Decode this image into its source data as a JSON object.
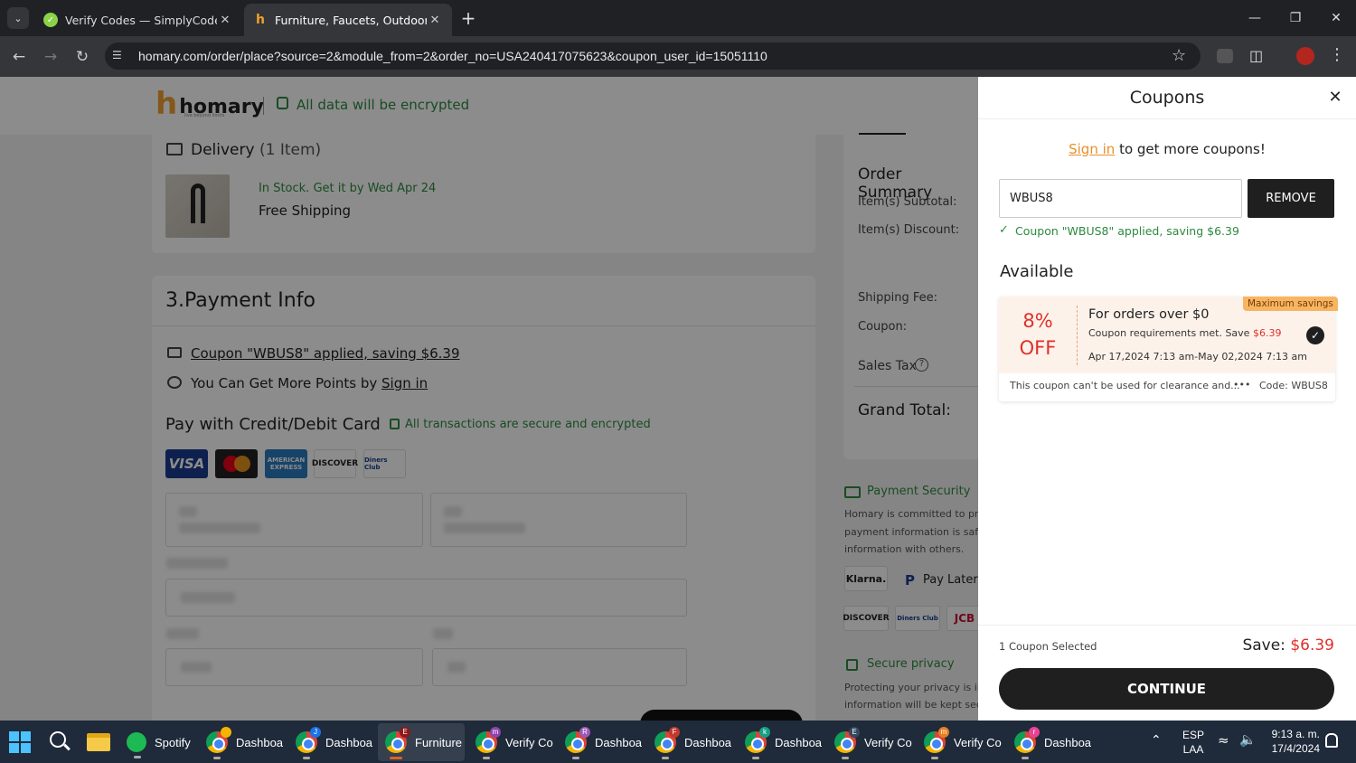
{
  "browser": {
    "tabs": [
      {
        "title": "Verify Codes — SimplyCodes",
        "active": false
      },
      {
        "title": "Furniture, Faucets, Outdoor, Lig",
        "active": true
      }
    ],
    "url": "homary.com/order/place?source=2&module_from=2&order_no=USA240417075623&coupon_user_id=15051110"
  },
  "header": {
    "logo": "homary",
    "logo_tagline": "live beyond limits",
    "encrypted_text": "All data will be encrypted"
  },
  "delivery": {
    "title": "Delivery",
    "count": "(1 Item)",
    "stock_text": "In Stock. Get it by Wed Apr 24",
    "shipping": "Free Shipping"
  },
  "payment": {
    "title": "3.Payment Info",
    "coupon_applied": "Coupon \"WBUS8\" applied, saving $6.39",
    "points_prefix": "You Can Get More Points by",
    "points_link": "Sign in",
    "card_title": "Pay with Credit/Debit Card",
    "secure_text": "All transactions are secure and encrypted",
    "card_logos": [
      "VISA",
      "mastercard",
      "AMERICAN EXPRESS",
      "DISCOVER",
      "Diners Club"
    ]
  },
  "order_summary": {
    "title": "Order Summary",
    "rows": [
      "Item(s) Subtotal:",
      "Item(s) Discount:",
      "Shipping Fee:",
      "Coupon:",
      "Sales Tax"
    ],
    "grand_total": "Grand Total:"
  },
  "security": {
    "title": "Payment Security",
    "text_lines": [
      "Homary is committed to prot",
      "payment information is safe",
      "information with others."
    ],
    "klarna": "Klarna.",
    "pay_later": "Pay Later",
    "logos": [
      "DISCOVER",
      "Diners Club",
      "JCB"
    ],
    "privacy_title": "Secure privacy",
    "privacy_lines": [
      "Protecting your privacy is imp",
      "information will be kept secu"
    ]
  },
  "coupons_panel": {
    "title": "Coupons",
    "signin_link": "Sign in",
    "signin_text": "to get more coupons!",
    "input_value": "WBUS8",
    "remove_label": "REMOVE",
    "applied_message": "Coupon \"WBUS8\" applied, saving $6.39",
    "available_title": "Available",
    "coupon": {
      "badge": "Maximum savings",
      "percent": "8%",
      "off": "OFF",
      "title": "For orders over $0",
      "req_text": "Coupon requirements met. Save",
      "req_amount": "$6.39",
      "dates": "Apr 17,2024 7:13 am-May 02,2024 7:13 am",
      "note": "This coupon can't be used for clearance and...",
      "more": "•••",
      "code": "Code: WBUS8",
      "selected": true
    },
    "footer": {
      "selected_count": "1 Coupon Selected",
      "save_label": "Save:",
      "save_amount": "$6.39",
      "continue_label": "CONTINUE"
    }
  },
  "taskbar": {
    "items": [
      {
        "label": "Spotify",
        "badge": ""
      },
      {
        "label": "Dashboa",
        "badge": ""
      },
      {
        "label": "Dashboa",
        "badge": "J"
      },
      {
        "label": "Furniture",
        "badge": "E"
      },
      {
        "label": "Verify Co",
        "badge": "m"
      },
      {
        "label": "Dashboa",
        "badge": "R"
      },
      {
        "label": "Dashboa",
        "badge": "F"
      },
      {
        "label": "Dashboa",
        "badge": "k"
      },
      {
        "label": "Verify Co",
        "badge": "E"
      },
      {
        "label": "Verify Co",
        "badge": "m"
      },
      {
        "label": "Dashboa",
        "badge": "r"
      }
    ],
    "lang_top": "ESP",
    "lang_bottom": "LAA",
    "time": "9:13 a. m.",
    "date": "17/4/2024"
  },
  "colors": {
    "brand": "#222222",
    "accent_orange": "#e9902b",
    "coupon_red": "#e0302a",
    "success_green": "#2d8a3e",
    "coupon_bg": "#fdf2ea"
  }
}
